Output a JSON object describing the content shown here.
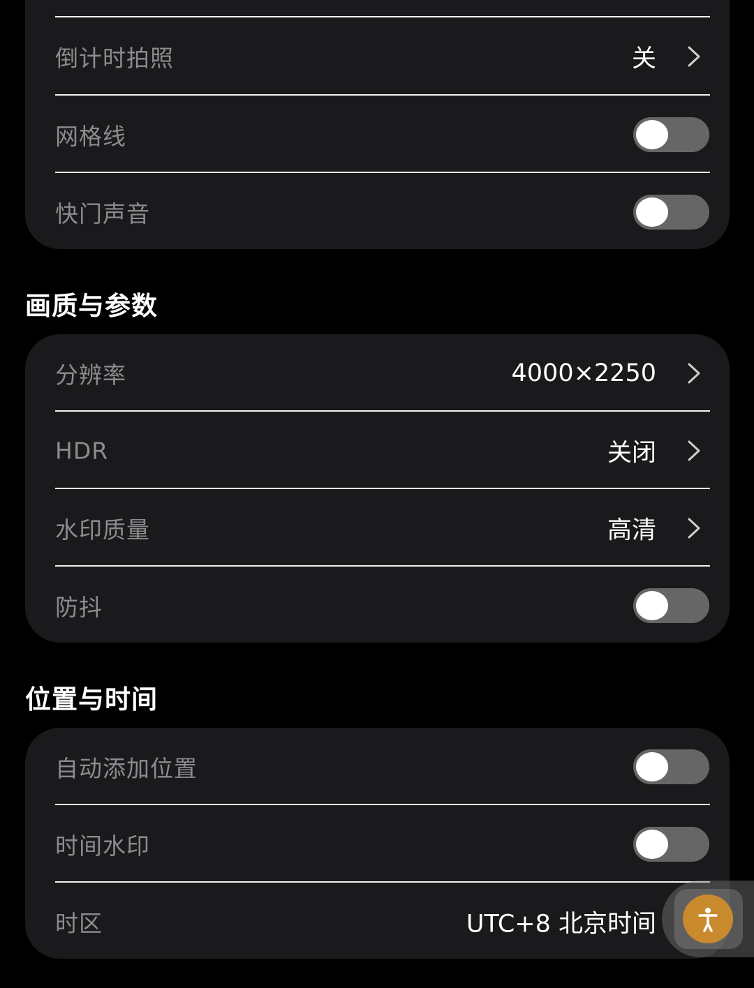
{
  "top_group": {
    "countdown": {
      "label": "倒计时拍照",
      "value": "关"
    },
    "grid_lines": {
      "label": "网格线",
      "enabled": false
    },
    "shutter_sound": {
      "label": "快门声音",
      "enabled": false
    }
  },
  "quality_section": {
    "title": "画质与参数",
    "resolution": {
      "label": "分辨率",
      "value": "4000×2250"
    },
    "hdr": {
      "label": "HDR",
      "value": "关闭"
    },
    "watermark_quality": {
      "label": "水印质量",
      "value": "高清"
    },
    "stabilization": {
      "label": "防抖",
      "enabled": false
    }
  },
  "location_section": {
    "title": "位置与时间",
    "auto_location": {
      "label": "自动添加位置",
      "enabled": false
    },
    "time_watermark": {
      "label": "时间水印",
      "enabled": false
    },
    "timezone": {
      "label": "时区",
      "value": "UTC+8 北京时间"
    }
  },
  "icons": {
    "chevron": "chevron-right-icon",
    "accessibility": "accessibility-icon"
  },
  "colors": {
    "background": "#000000",
    "card": "#1a1a1c",
    "label": "#8c8c8e",
    "toggle_off_track": "#666666",
    "accessibility_accent": "#c98a2e"
  }
}
